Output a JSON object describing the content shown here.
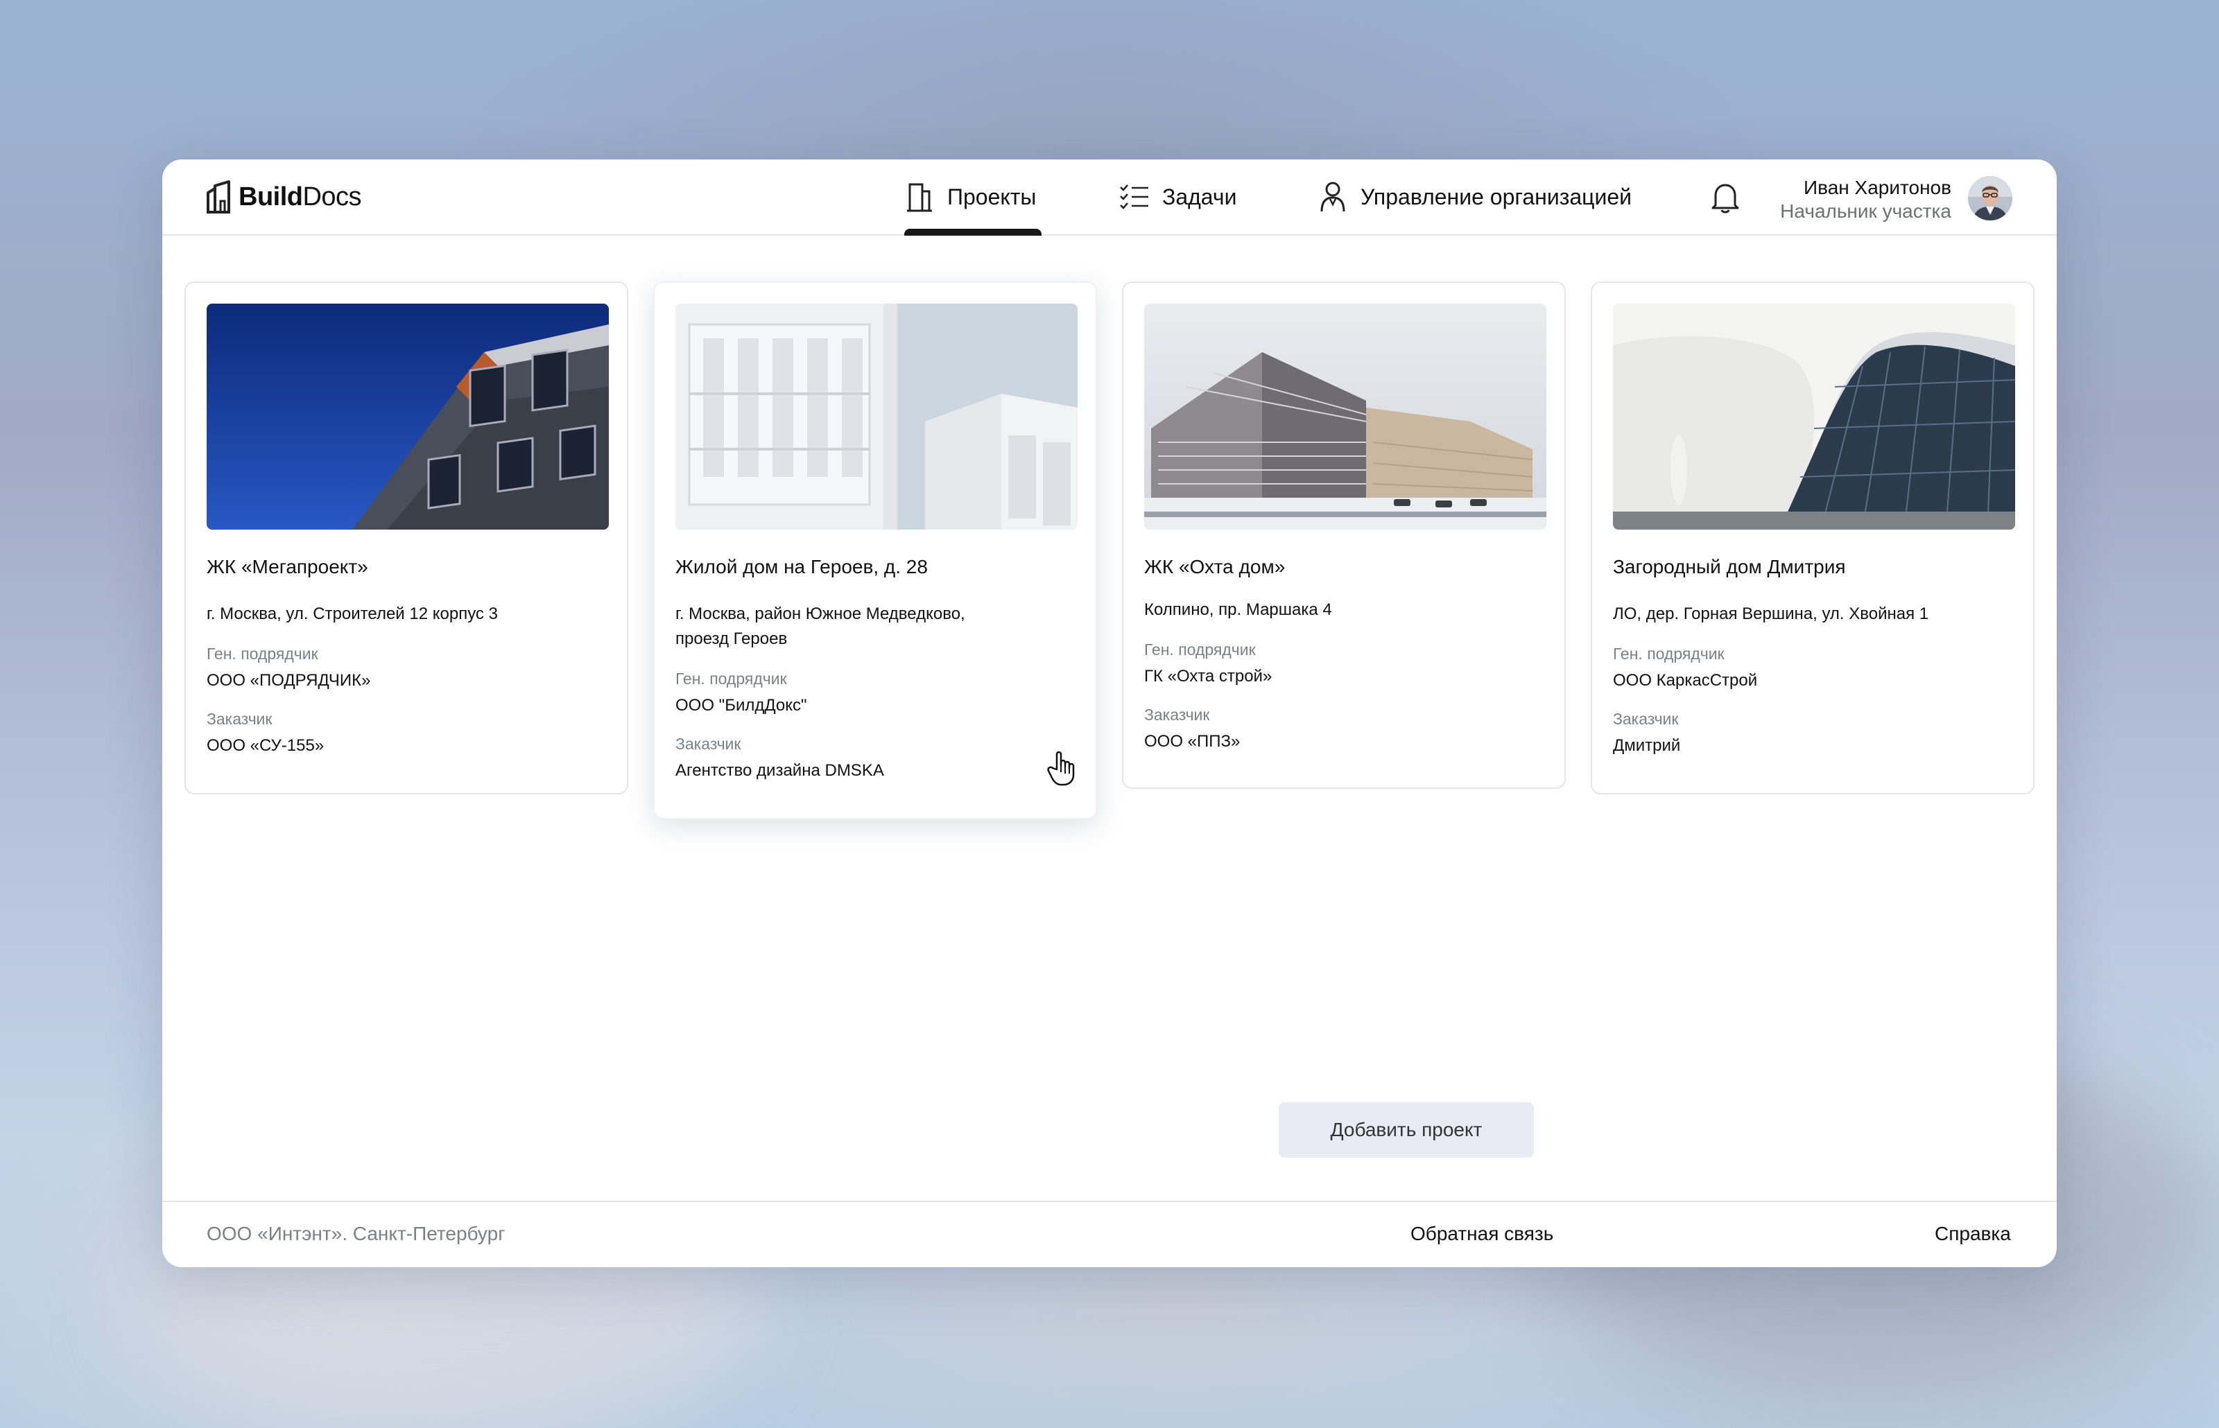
{
  "header": {
    "logo": {
      "bold": "Build",
      "light": "Docs",
      "icon": "building-logo-icon"
    },
    "nav": [
      {
        "label": "Проекты",
        "icon": "building-icon",
        "active": true
      },
      {
        "label": "Задачи",
        "icon": "checklist-icon",
        "active": false
      },
      {
        "label": "Управление организацией",
        "icon": "person-icon",
        "active": false
      }
    ],
    "user": {
      "name": "Иван Харитонов",
      "role": "Начальник участка"
    }
  },
  "projects": [
    {
      "title": "ЖК «Мегапроект»",
      "address": "г. Москва, ул. Строителей 12 корпус 3",
      "contractor_label": "Ген. подрядчик",
      "contractor": "ООО «ПОДРЯДЧИК»",
      "customer_label": "Заказчик",
      "customer": "ООО «СУ-155»"
    },
    {
      "title": "Жилой дом на Героев, д. 28",
      "address": "г. Москва, район Южное Медведково, проезд Героев",
      "contractor_label": "Ген. подрядчик",
      "contractor": "ООО \"БилдДокс\"",
      "customer_label": "Заказчик",
      "customer": "Агентство дизайна DMSKA"
    },
    {
      "title": "ЖК «Охта дом»",
      "address": "Колпино, пр. Маршака 4",
      "contractor_label": "Ген. подрядчик",
      "contractor": "ГК «Охта строй»",
      "customer_label": "Заказчик",
      "customer": "ООО «ППЗ»"
    },
    {
      "title": "Загородный дом Дмитрия",
      "address": "ЛО, дер. Горная Вершина, ул. Хвойная 1",
      "contractor_label": "Ген. подрядчик",
      "contractor": "ООО КаркасСтрой",
      "customer_label": "Заказчик",
      "customer": "Дмитрий"
    }
  ],
  "actions": {
    "add_project": "Добавить проект"
  },
  "footer": {
    "company": "ООО «Интэнт». Санкт-Петербург",
    "feedback": "Обратная связь",
    "help": "Справка"
  },
  "colors": {
    "accent": "#1a1a1a",
    "button_bg": "#e8ebf4",
    "muted": "#7b7f86",
    "border": "#e4e6ea"
  }
}
